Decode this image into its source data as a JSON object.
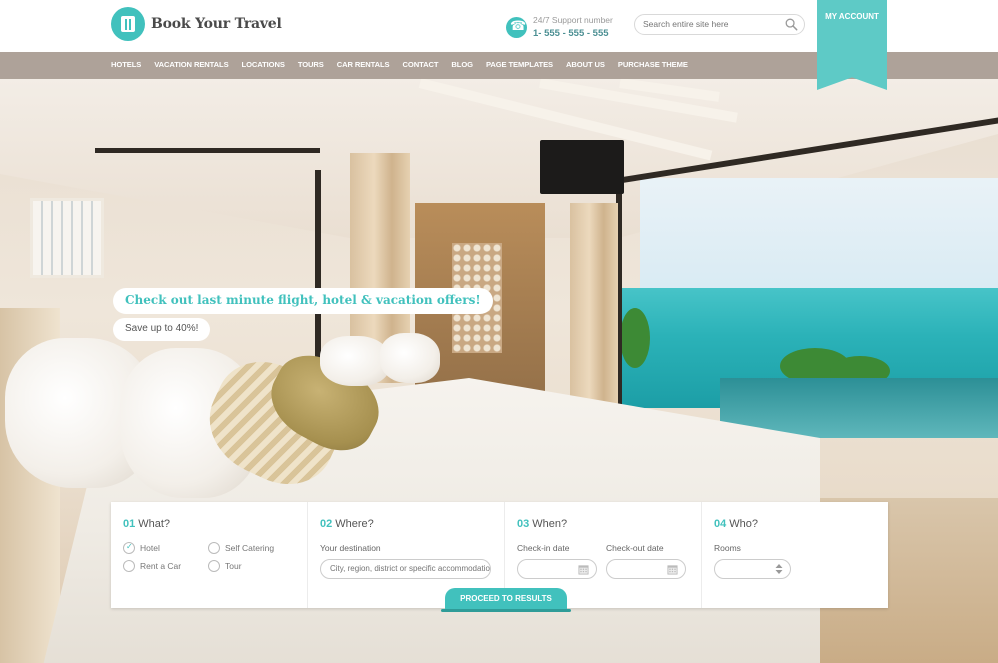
{
  "header": {
    "brand": "Book Your Travel",
    "support_label": "24/7 Support number",
    "support_number": "1- 555 - 555 - 555",
    "search_placeholder": "Search entire site here",
    "my_account": "MY ACCOUNT"
  },
  "nav": {
    "items": [
      "HOTELS",
      "VACATION RENTALS",
      "LOCATIONS",
      "TOURS",
      "CAR RENTALS",
      "CONTACT",
      "BLOG",
      "PAGE TEMPLATES",
      "ABOUT US",
      "PURCHASE THEME"
    ]
  },
  "promo": {
    "title": "Check out last minute flight, hotel & vacation offers!",
    "subtitle": "Save up to 40%!"
  },
  "search_panel": {
    "what": {
      "num": "01",
      "title": "What?",
      "options": [
        "Hotel",
        "Self Catering",
        "Rent a Car",
        "Tour"
      ],
      "selected": "Hotel"
    },
    "where": {
      "num": "02",
      "title": "Where?",
      "label": "Your destination",
      "placeholder": "City, region, district or specific accommodation"
    },
    "when": {
      "num": "03",
      "title": "When?",
      "checkin_label": "Check-in date",
      "checkout_label": "Check-out date"
    },
    "who": {
      "num": "04",
      "title": "Who?",
      "rooms_label": "Rooms"
    },
    "proceed": "PROCEED TO RESULTS"
  },
  "colors": {
    "accent": "#41c1bd",
    "nav_bg": "#a89c92",
    "ribbon": "#5ecac6"
  },
  "icons": {
    "logo": "suitcase-icon",
    "phone": "phone-icon",
    "search": "search-icon",
    "calendar": "calendar-icon",
    "select": "updown-arrows-icon"
  }
}
